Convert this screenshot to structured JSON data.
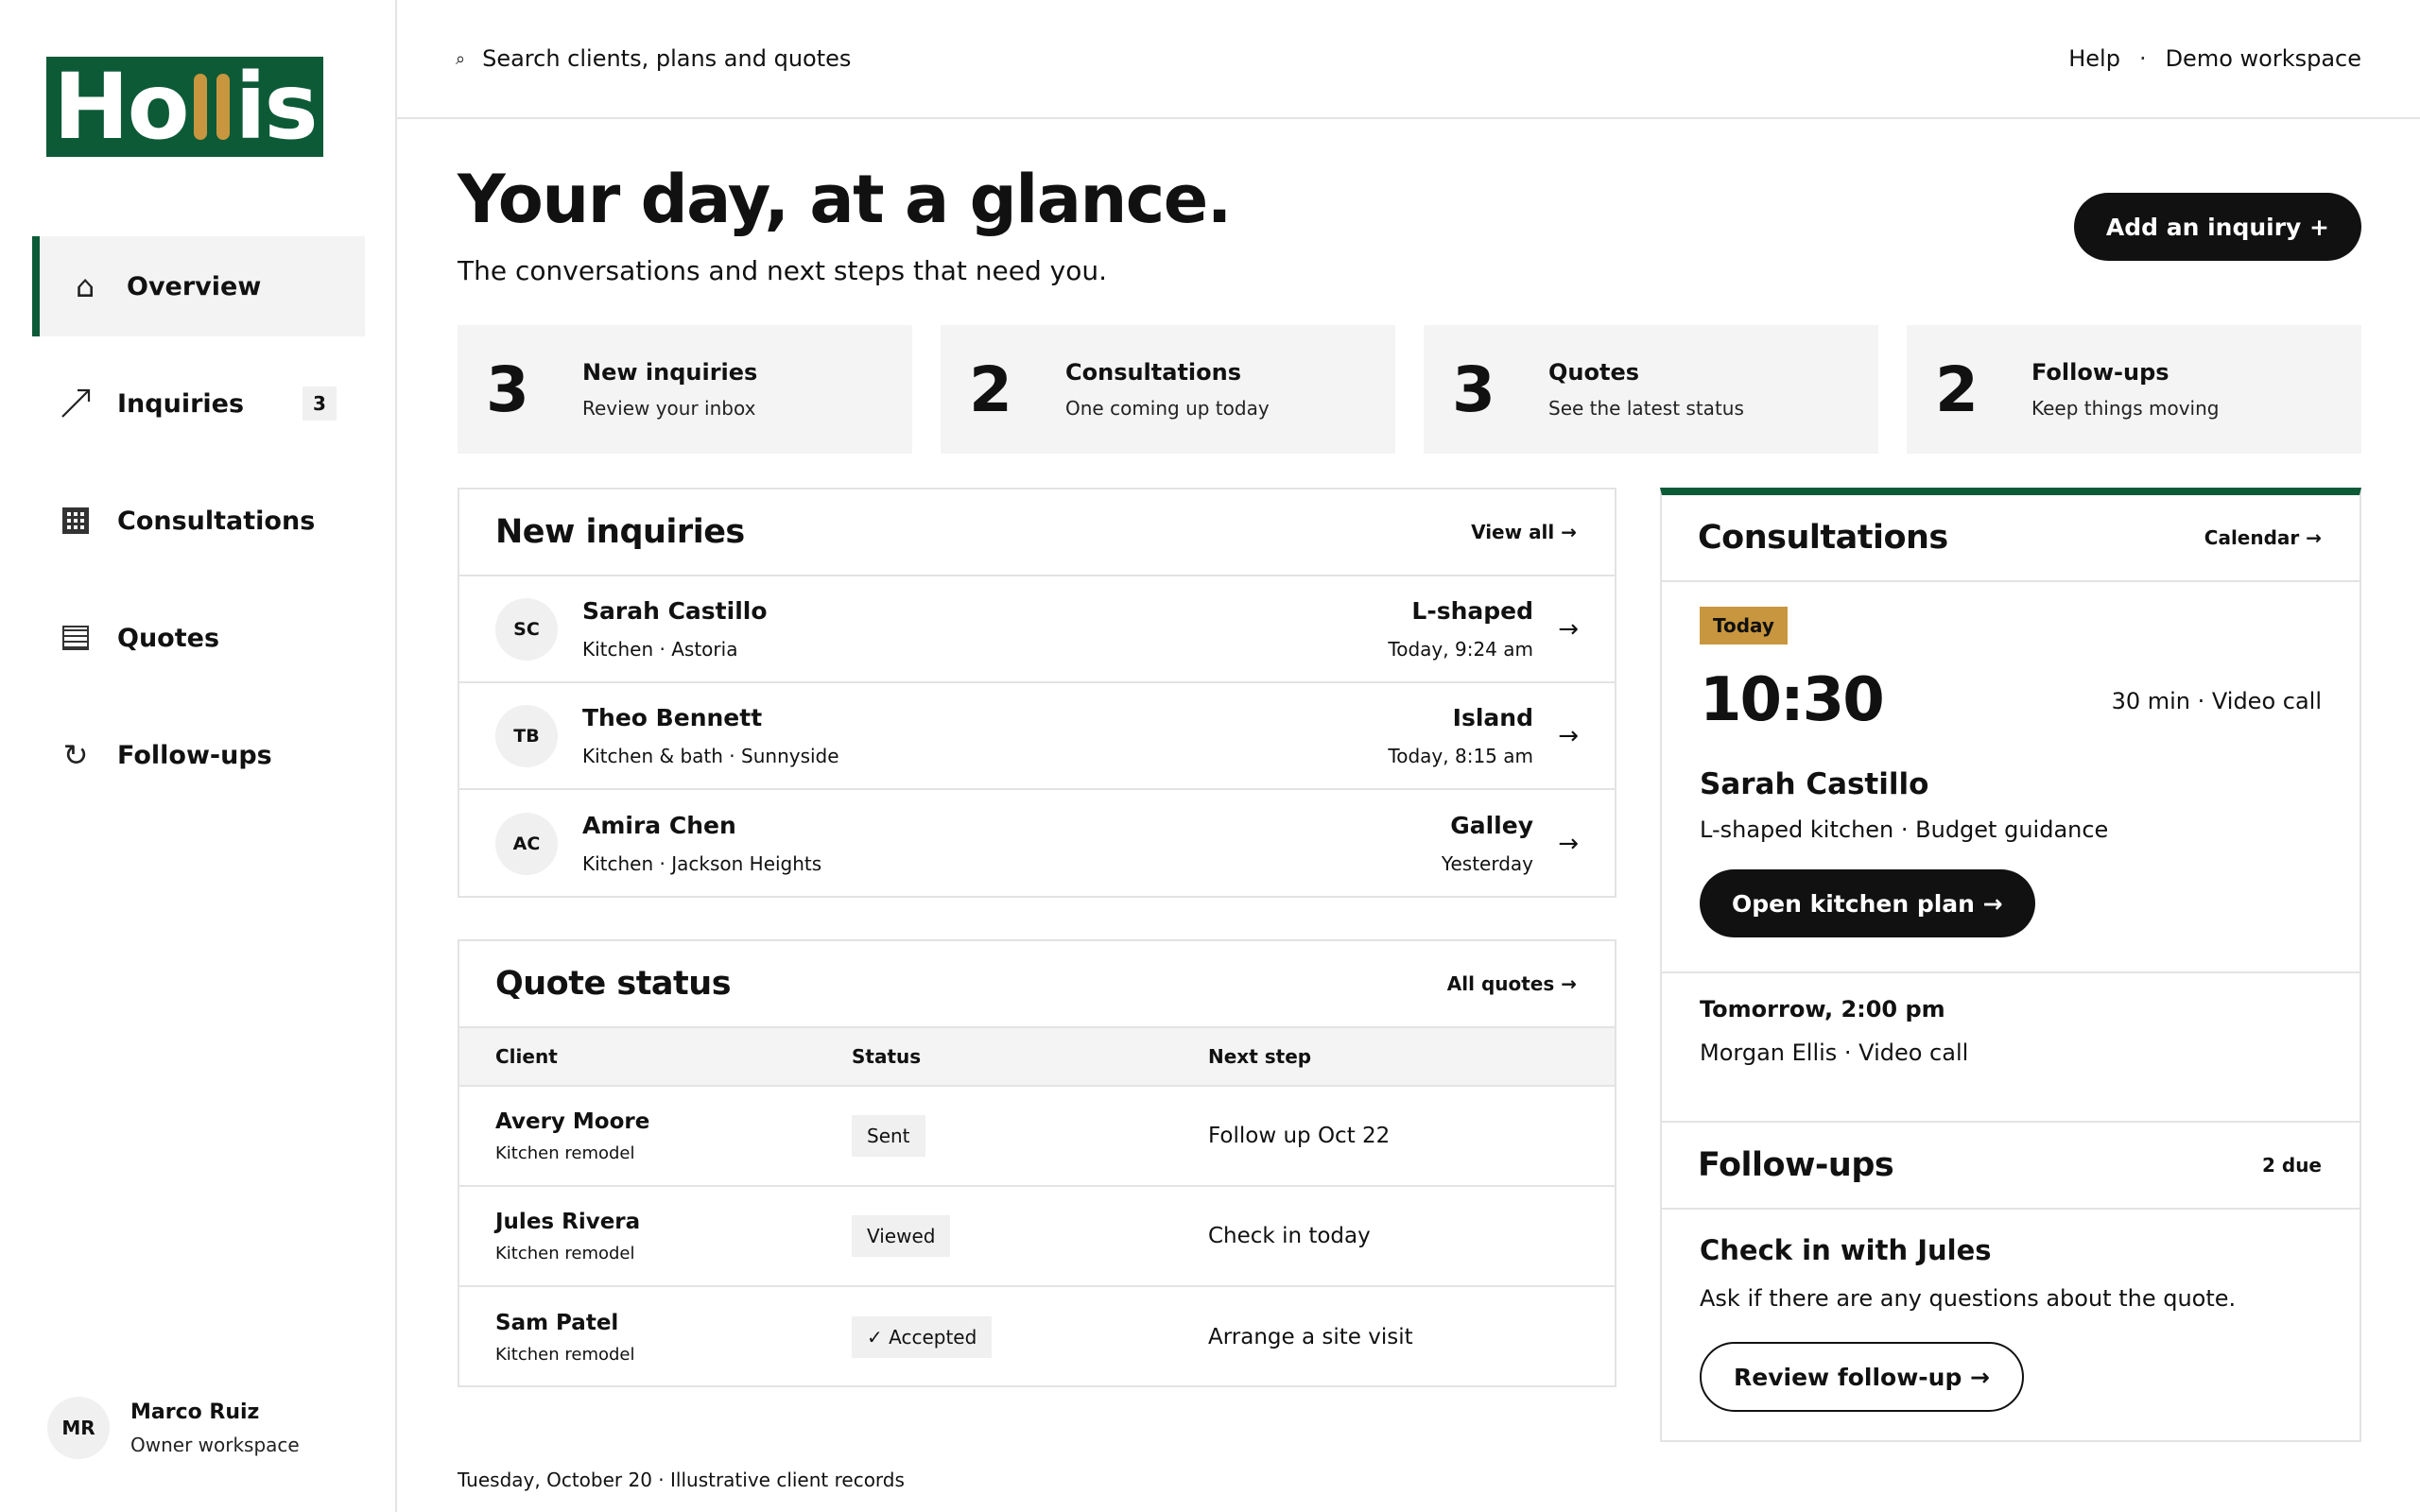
{
  "brand": {
    "name_start": "Ho",
    "name_end": "is",
    "color": "#0d5a37",
    "accent": "#c8963e"
  },
  "search": {
    "placeholder": "Search clients, plans and quotes"
  },
  "top_links": {
    "help": "Help",
    "separator": "·",
    "workspace": "Demo workspace"
  },
  "nav": {
    "items": [
      {
        "label": "Overview",
        "icon": "home-icon",
        "active": true
      },
      {
        "label": "Inquiries",
        "icon": "arrow-up-right-icon",
        "badge": "3"
      },
      {
        "label": "Consultations",
        "icon": "calendar-grid-icon"
      },
      {
        "label": "Quotes",
        "icon": "document-lines-icon"
      },
      {
        "label": "Follow-ups",
        "icon": "refresh-icon"
      }
    ]
  },
  "user": {
    "initials": "MR",
    "name": "Marco Ruiz",
    "role": "Owner workspace"
  },
  "header": {
    "title": "Your day, at a glance.",
    "subtitle": "The conversations and next steps that need you.",
    "add_button": "Add an inquiry +"
  },
  "stats": [
    {
      "num": "3",
      "title": "New inquiries",
      "sub": "Review your inbox"
    },
    {
      "num": "2",
      "title": "Consultations",
      "sub": "One coming up today"
    },
    {
      "num": "3",
      "title": "Quotes",
      "sub": "See the latest status"
    },
    {
      "num": "2",
      "title": "Follow-ups",
      "sub": "Keep things moving"
    }
  ],
  "inquiries": {
    "title": "New inquiries",
    "link": "View all →",
    "rows": [
      {
        "initials": "SC",
        "name": "Sarah Castillo",
        "sub": "Kitchen · Astoria",
        "type": "L-shaped",
        "time": "Today, 9:24 am",
        "arrow": "→"
      },
      {
        "initials": "TB",
        "name": "Theo Bennett",
        "sub": "Kitchen & bath · Sunnyside",
        "type": "Island",
        "time": "Today, 8:15 am",
        "arrow": "→"
      },
      {
        "initials": "AC",
        "name": "Amira Chen",
        "sub": "Kitchen · Jackson Heights",
        "type": "Galley",
        "time": "Yesterday",
        "arrow": "→"
      }
    ]
  },
  "quotes": {
    "title": "Quote status",
    "link": "All quotes →",
    "columns": [
      "Client",
      "Status",
      "Next step"
    ],
    "rows": [
      {
        "name": "Avery Moore",
        "sub": "Kitchen remodel",
        "status": "Sent",
        "next": "Follow up Oct 22"
      },
      {
        "name": "Jules Rivera",
        "sub": "Kitchen remodel",
        "status": "Viewed",
        "next": "Check in today"
      },
      {
        "name": "Sam Patel",
        "sub": "Kitchen remodel",
        "status": "✓ Accepted",
        "next": "Arrange a site visit"
      }
    ]
  },
  "consultations": {
    "title": "Consultations",
    "link": "Calendar →",
    "badge": "Today",
    "time": "10:30",
    "meta": "30 min · Video call",
    "name": "Sarah Castillo",
    "desc": "L-shaped kitchen · Budget guidance",
    "button": "Open kitchen plan →",
    "next_title": "Tomorrow, 2:00 pm",
    "next_sub": "Morgan Ellis · Video call"
  },
  "followups": {
    "title": "Follow-ups",
    "count": "2 due",
    "item_title": "Check in with Jules",
    "item_desc": "Ask if there are any questions about the quote.",
    "button": "Review follow-up →"
  },
  "footer": {
    "note": "Tuesday, October 20 · Illustrative client records"
  }
}
